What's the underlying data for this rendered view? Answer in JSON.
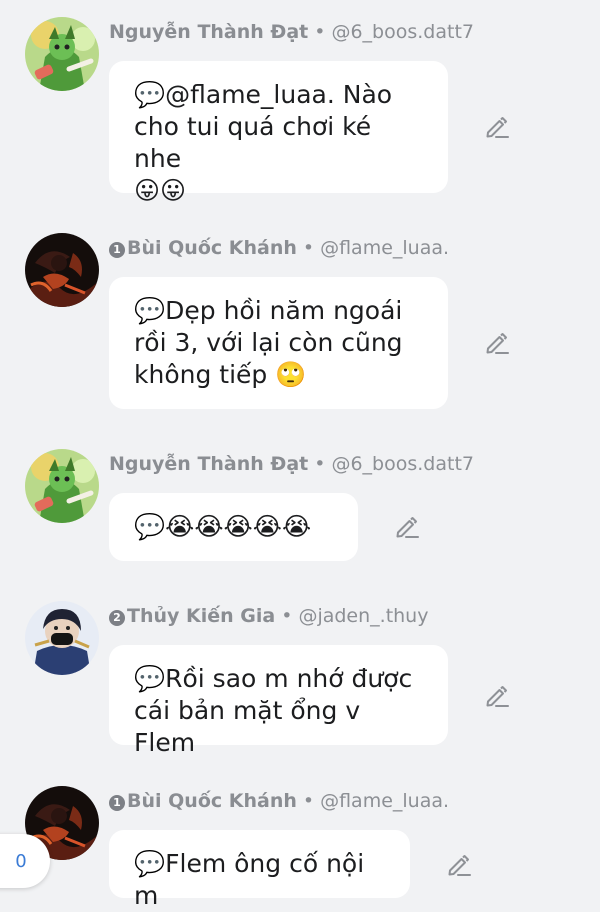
{
  "messages": [
    {
      "avatar": "green-character-avatar",
      "rank": "",
      "name": "Nguyễn Thành Đạt",
      "handle": "@6_boos.datt7",
      "text": "💬@flame_luaa. Nào\ncho tui quá chơi ké nhe\n😛😛"
    },
    {
      "avatar": "dark-fire-avatar",
      "rank": "1",
      "name": "Bùi Quốc Khánh",
      "handle": "@flame_luaa.",
      "text": "💬Dẹp hồi năm ngoái\nrồi 3, với lại còn cũng\nkhông tiếp 🙄"
    },
    {
      "avatar": "green-character-avatar",
      "rank": "",
      "name": "Nguyễn Thành Đạt",
      "handle": "@6_boos.datt7",
      "text": "💬😭😭😭😭😭"
    },
    {
      "avatar": "masked-character-avatar",
      "rank": "2",
      "name": "Thủy Kiến Gia",
      "handle": "@jaden_.thuy",
      "text": "💬Rồi sao m nhớ được\ncái bản mặt ổng v Flem"
    },
    {
      "avatar": "dark-fire-avatar",
      "rank": "1",
      "name": "Bùi Quốc Khánh",
      "handle": "@flame_luaa.",
      "text": "💬Flem ông cố nội m"
    }
  ],
  "separator": "•",
  "counter": "0",
  "icons": {
    "edit": "pencil-icon"
  }
}
